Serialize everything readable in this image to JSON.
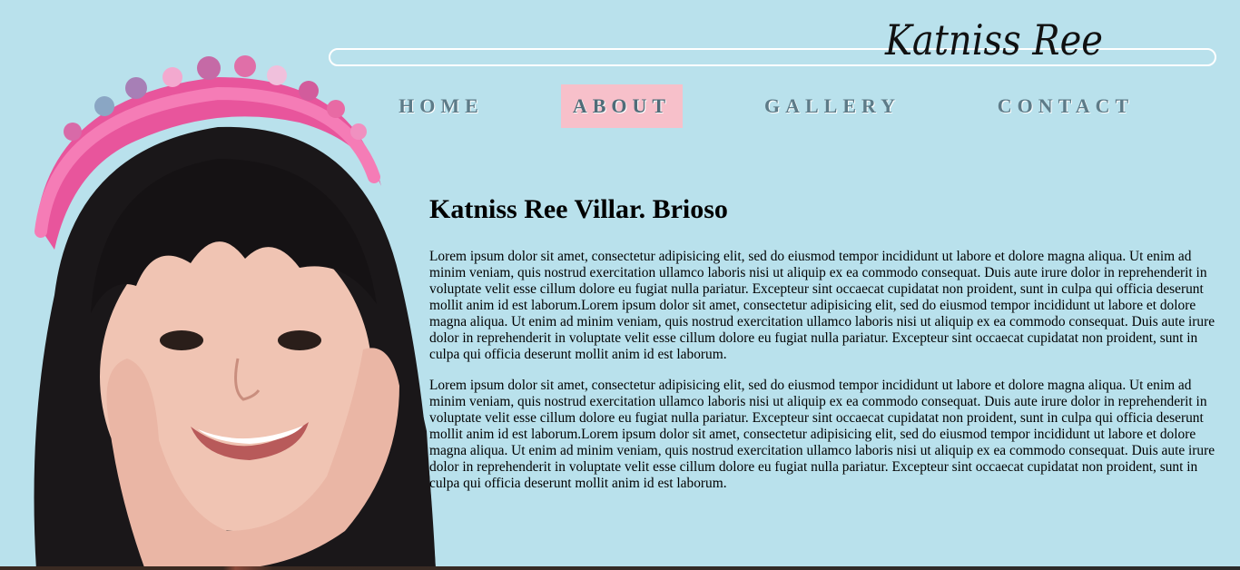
{
  "logo": {
    "text": "Katniss Ree"
  },
  "nav": {
    "home": "HOME",
    "about": "ABOUT",
    "gallery": "GALLERY",
    "contact": "CONTACT",
    "active": "about"
  },
  "profile": {
    "name": "Katniss Ree Villar. Brioso",
    "paragraphs": [
      "Lorem ipsum dolor sit amet, consectetur adipisicing elit, sed do eiusmod tempor incididunt ut labore et dolore magna aliqua. Ut enim ad minim veniam, quis nostrud exercitation ullamco laboris nisi ut aliquip ex ea commodo consequat. Duis aute irure dolor in reprehenderit in voluptate velit esse cillum dolore eu fugiat nulla pariatur. Excepteur sint occaecat cupidatat non proident, sunt in culpa qui officia deserunt mollit anim id est laborum.Lorem ipsum dolor sit amet, consectetur adipisicing elit, sed do eiusmod tempor incididunt ut labore et dolore magna aliqua. Ut enim ad minim veniam, quis nostrud exercitation ullamco laboris nisi ut aliquip ex ea commodo consequat. Duis aute irure dolor in reprehenderit in voluptate velit esse cillum dolore eu fugiat nulla pariatur. Excepteur sint occaecat cupidatat non proident, sunt in culpa qui officia deserunt mollit anim id est laborum.",
      "Lorem ipsum dolor sit amet, consectetur adipisicing elit, sed do eiusmod tempor incididunt ut labore et dolore magna aliqua. Ut enim ad minim veniam, quis nostrud exercitation ullamco laboris nisi ut aliquip ex ea commodo consequat. Duis aute irure dolor in reprehenderit in voluptate velit esse cillum dolore eu fugiat nulla pariatur. Excepteur sint occaecat cupidatat non proident, sunt in culpa qui officia deserunt mollit anim id est laborum.Lorem ipsum dolor sit amet, consectetur adipisicing elit, sed do eiusmod tempor incididunt ut labore et dolore magna aliqua. Ut enim ad minim veniam, quis nostrud exercitation ullamco laboris nisi ut aliquip ex ea commodo consequat. Duis aute irure dolor in reprehenderit in voluptate velit esse cillum dolore eu fugiat nulla pariatur. Excepteur sint occaecat cupidatat non proident, sunt in culpa qui officia deserunt mollit anim id est laborum."
    ]
  },
  "colors": {
    "background": "#b9e1ec",
    "nav_active": "#f7c0ca",
    "nav_text": "#5d7b88"
  }
}
